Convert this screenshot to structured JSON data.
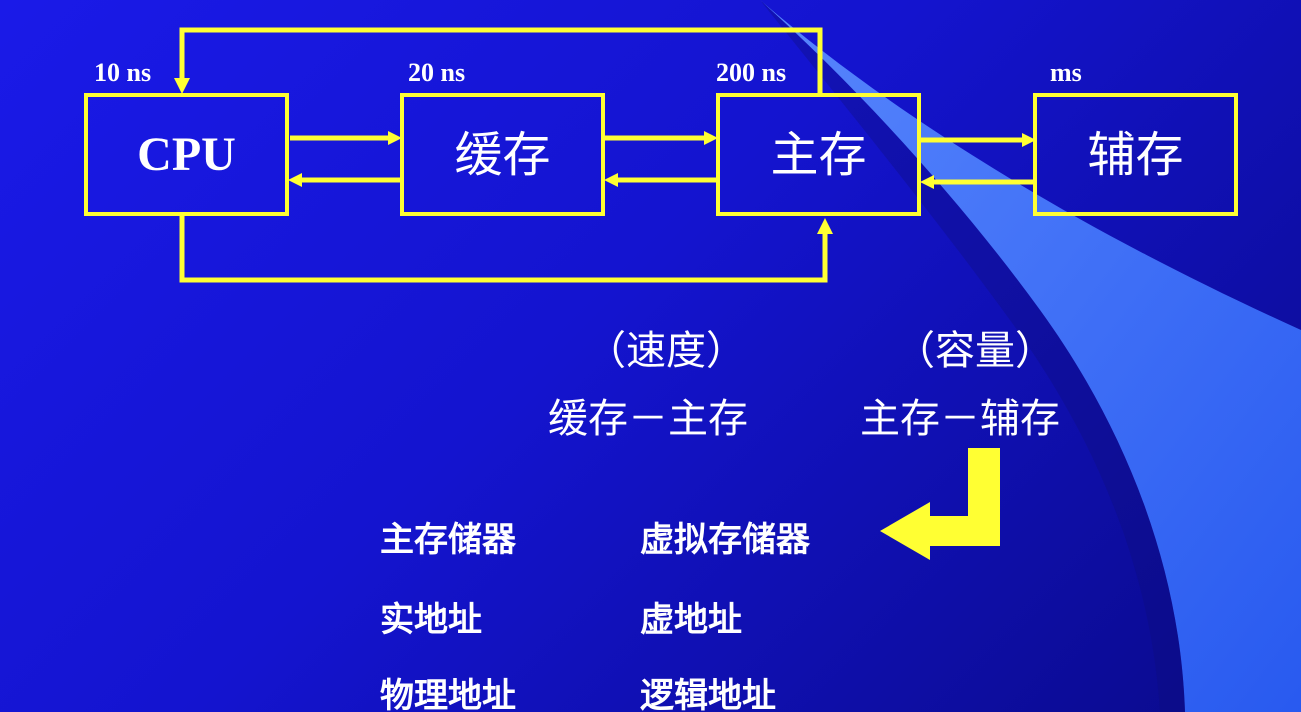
{
  "diagram": {
    "latencies": {
      "cpu": "10 ns",
      "cache": "20 ns",
      "main": "200 ns",
      "aux": "ms"
    },
    "nodes": {
      "cpu": "CPU",
      "cache": "缓存",
      "main": "主存",
      "aux": "辅存"
    }
  },
  "hierarchy": {
    "speed_label": "（速度）",
    "capacity_label": "（容量）",
    "cache_main": "缓存－主存",
    "main_aux": "主存－辅存"
  },
  "table": {
    "rows": [
      {
        "left": "主存储器",
        "right": "虚拟存储器"
      },
      {
        "left": "实地址",
        "right": "虚地址"
      },
      {
        "left": "物理地址",
        "right": "逻辑地址"
      }
    ]
  },
  "colors": {
    "accent": "#ffff33",
    "background": "#1414cf",
    "text": "#ffffff"
  }
}
